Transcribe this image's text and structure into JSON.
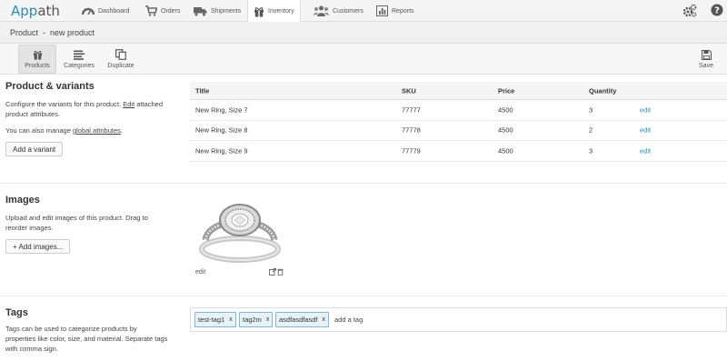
{
  "app": {
    "logo_part1": "App",
    "logo_part2": "ath"
  },
  "nav": {
    "items": [
      {
        "label": "Dashboard",
        "icon": "dashboard-icon"
      },
      {
        "label": "Orders",
        "icon": "cart-icon"
      },
      {
        "label": "Shipments",
        "icon": "truck-icon"
      },
      {
        "label": "Inventory",
        "icon": "gift-icon",
        "active": true
      },
      {
        "label": "Customers",
        "icon": "users-icon"
      },
      {
        "label": "Reports",
        "icon": "bar-chart-icon"
      }
    ],
    "right_icons": [
      "settings-icon",
      "help-icon"
    ]
  },
  "breadcrumb": {
    "text": "Product  -  new product"
  },
  "toolbar": {
    "products_label": "Products",
    "categories_label": "Categories",
    "duplicate_label": "Duplicate",
    "save_label": "Save"
  },
  "variants": {
    "title": "Product & variants",
    "desc_1": "Configure the variants for this product. ",
    "desc_edit_link": "Edit",
    "desc_2": " attached product attributes.",
    "manage_1": "You can also manage ",
    "manage_link": "global attributes",
    "manage_2": ".",
    "add_button": "Add a variant",
    "table": {
      "headers": {
        "title": "Title",
        "sku": "SKU",
        "price": "Price",
        "quantity": "Quantity"
      },
      "rows": [
        {
          "title": "New Ring, Size 7",
          "sku": "77777",
          "price": "4500",
          "quantity": "3",
          "action": "edit"
        },
        {
          "title": "New Ring, Size 8",
          "sku": "77778",
          "price": "4500",
          "quantity": "2",
          "action": "edit"
        },
        {
          "title": "New Ring, Size 9",
          "sku": "77779",
          "price": "4500",
          "quantity": "3",
          "action": "edit"
        }
      ]
    }
  },
  "images": {
    "title": "Images",
    "desc": "Upload and edit images of this product. Drag to reorder images.",
    "add_button": "+ Add images...",
    "image_edit_label": "edit"
  },
  "tags": {
    "title": "Tags",
    "desc": "Tags can be used to categorize products by properties like color, size, and material. Separate tags with comma sign.",
    "items": [
      "test-tag1",
      "tag2m",
      "asdfasdfasdf"
    ],
    "remove_glyph": "x",
    "placeholder": "add a tag"
  },
  "colors": {
    "brand": "#2a8bb5",
    "tag_border": "#7fb8d0",
    "tag_bg": "#e6f2f7"
  }
}
